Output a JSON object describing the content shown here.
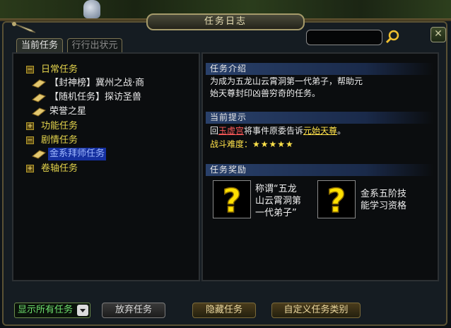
{
  "window": {
    "title": "任务日志"
  },
  "tabs": [
    {
      "label": "当前任务",
      "active": true
    },
    {
      "label": "行行出状元",
      "active": false
    }
  ],
  "tree": {
    "categories": [
      {
        "label": "日常任务",
        "expanded": true,
        "symbol": "−",
        "items": [
          "【封神榜】冀州之战·商",
          "【随机任务】探访圣兽",
          "荣誉之星"
        ]
      },
      {
        "label": "功能任务",
        "expanded": false,
        "symbol": "+"
      },
      {
        "label": "剧情任务",
        "expanded": true,
        "symbol": "−",
        "items": [
          "金系拜师任务"
        ]
      },
      {
        "label": "卷轴任务",
        "expanded": false,
        "symbol": "+"
      }
    ],
    "selected_item": "金系拜师任务"
  },
  "detail": {
    "intro_header": "任务介绍",
    "intro_line1": "为成为五龙山云霄洞第一代弟子，帮助元",
    "intro_line2": "始天尊封印凶兽穷奇的任务。",
    "hint_header": "当前提示",
    "hint_prefix": "回",
    "hint_place": "玉虚宫",
    "hint_middle": "将事件原委告诉",
    "hint_person": "元始天尊",
    "hint_suffix": "。",
    "difficulty_label": "战斗难度：",
    "difficulty_stars": "★★★★★",
    "difficulty_value": 5,
    "reward_header": "任务奖励",
    "reward1_line1": "称谓“五龙",
    "reward1_line2": "山云霄洞第",
    "reward1_line3": "一代弟子”",
    "reward2_line1": "金系五阶技",
    "reward2_line2": "能学习资格"
  },
  "bottom": {
    "filter_value": "显示所有任务",
    "abandon_label": "放弃任务",
    "hide_label": "隐藏任务",
    "custom_label": "自定义任务类别"
  },
  "colors": {
    "category": "#e4d44c",
    "selected_bg": "#1530a0",
    "link_red": "#ff5a5a",
    "link_yellow": "#ffe24a",
    "filter_green": "#6ee06e"
  }
}
